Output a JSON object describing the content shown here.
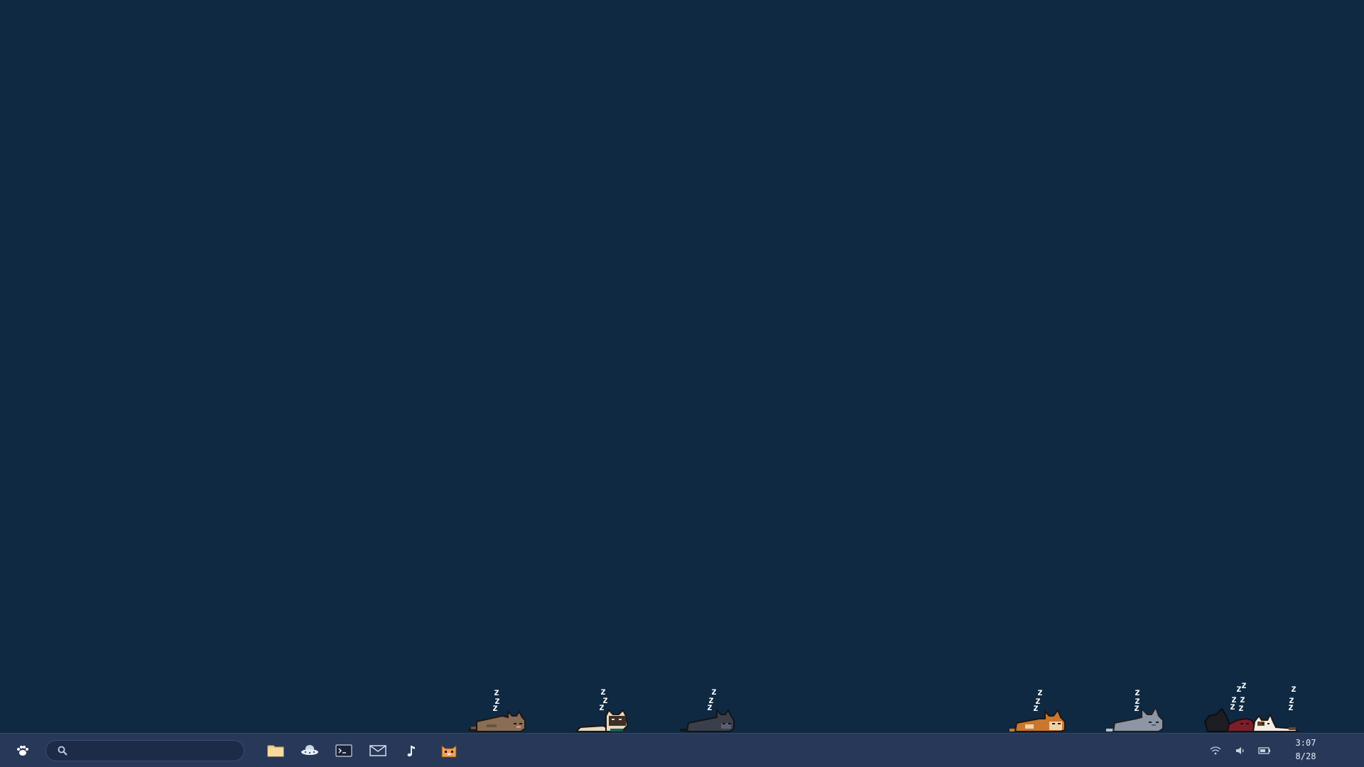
{
  "taskbar": {
    "start_icon": "paw-icon",
    "search": {
      "placeholder": "",
      "value": "",
      "icon": "search-icon"
    },
    "apps": [
      {
        "name": "files",
        "icon": "folder-icon"
      },
      {
        "name": "browser",
        "icon": "ufo-icon"
      },
      {
        "name": "terminal",
        "icon": "terminal-icon"
      },
      {
        "name": "mail",
        "icon": "mail-icon"
      },
      {
        "name": "music",
        "icon": "music-note-icon"
      },
      {
        "name": "cat-app",
        "icon": "cat-face-icon"
      }
    ],
    "tray": [
      {
        "name": "wifi",
        "icon": "wifi-icon"
      },
      {
        "name": "volume",
        "icon": "speaker-icon"
      },
      {
        "name": "battery",
        "icon": "battery-icon"
      }
    ],
    "clock": {
      "time": "3:07",
      "date": "8/28"
    }
  },
  "desktop": {
    "background_color": "#102942",
    "sleep_text": "z",
    "cats": [
      {
        "name": "brown-cat",
        "color": "#8a6d55",
        "accent": "#6b513e"
      },
      {
        "name": "siamese-cat",
        "color": "#e8d9bf",
        "accent": "#3d2f28"
      },
      {
        "name": "dark-gray-cat",
        "color": "#3a3f4a",
        "accent": "#5a6070"
      },
      {
        "name": "orange-cat",
        "color": "#c9772e",
        "accent": "#f0d2a8"
      },
      {
        "name": "gray-cat",
        "color": "#8d96a4",
        "accent": "#b7c0cc"
      },
      {
        "name": "black-cat",
        "color": "#1d1d24",
        "accent": "#2c2c36"
      },
      {
        "name": "red-cat",
        "color": "#7a1f2a",
        "accent": "#a32b38"
      },
      {
        "name": "calico-cat",
        "color": "#f2ede4",
        "accent": "#6b4322"
      }
    ]
  },
  "colors": {
    "taskbar_bg": "#273858",
    "search_bg": "#1c2b47",
    "folder": "#f4d28a",
    "cat_icon": "#f0a259",
    "tray_icon": "#c9d2df"
  }
}
